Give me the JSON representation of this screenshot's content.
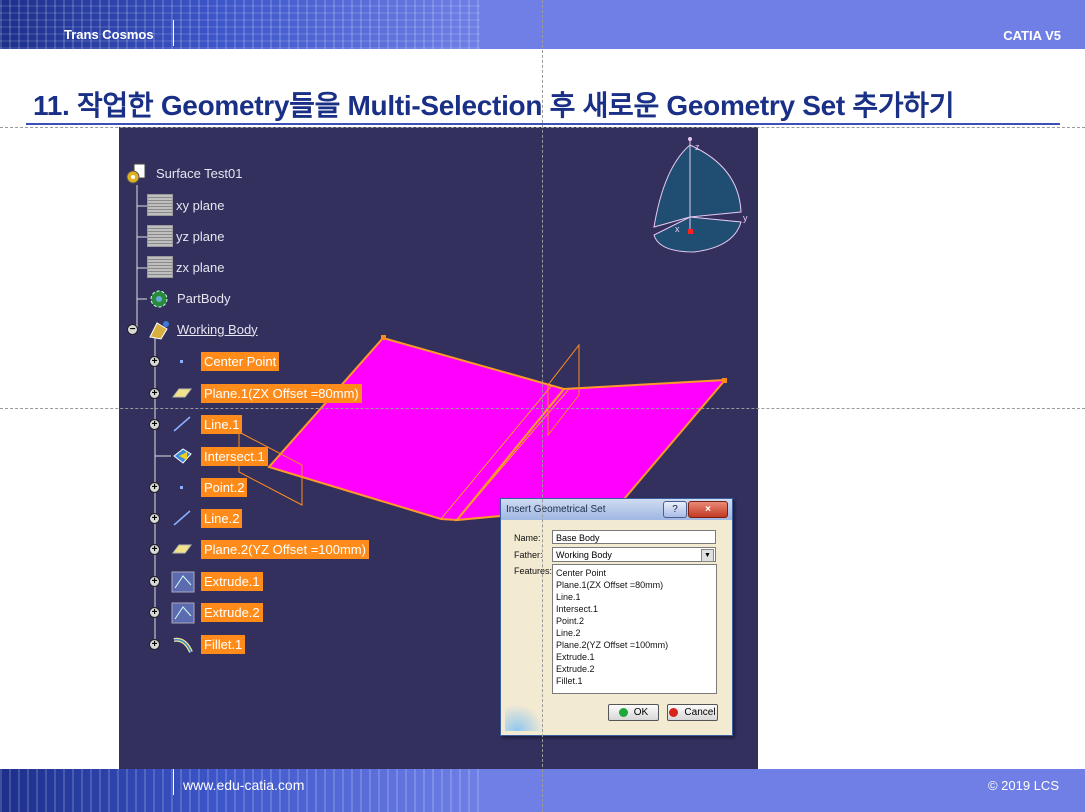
{
  "header": {
    "brand": "Trans Cosmos",
    "product": "CATIA V5"
  },
  "slide": {
    "title": "11. 작업한 Geometry들을 Multi-Selection 후 새로운 Geometry Set 추가하기"
  },
  "tree": {
    "root": "Surface Test01",
    "planes": [
      "xy plane",
      "yz plane",
      "zx plane"
    ],
    "part_body": "PartBody",
    "working_body": "Working Body",
    "items": [
      "Center Point",
      "Plane.1(ZX Offset =80mm)",
      "Line.1",
      "Intersect.1",
      "Point.2",
      "Line.2",
      "Plane.2(YZ Offset =100mm)",
      "Extrude.1",
      "Extrude.2",
      "Fillet.1"
    ]
  },
  "compass": {
    "z": "z",
    "y": "y",
    "x": "x"
  },
  "dialog": {
    "title": "Insert Geometrical Set",
    "help": "?",
    "close": "×",
    "name_label": "Name:",
    "name_value": "Base Body",
    "father_label": "Father:",
    "father_value": "Working Body",
    "features_label": "Features:",
    "features": [
      "Center Point",
      "Plane.1(ZX Offset =80mm)",
      "Line.1",
      "Intersect.1",
      "Point.2",
      "Line.2",
      "Plane.2(YZ Offset =100mm)",
      "Extrude.1",
      "Extrude.2",
      "Fillet.1"
    ],
    "ok": "OK",
    "cancel": "Cancel"
  },
  "footer": {
    "url": "www.edu-catia.com",
    "copyright": "© 2019 LCS"
  },
  "colors": {
    "selection": "#ff8c1a",
    "surface": "#ff00ff",
    "viewport_bg": "#33305e",
    "banner": "#6f7fe6",
    "title": "#1a2f86"
  }
}
